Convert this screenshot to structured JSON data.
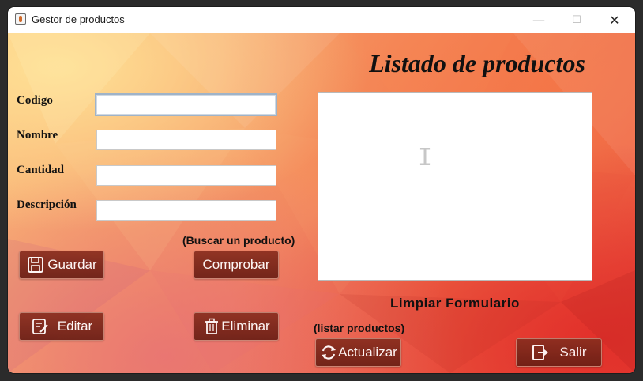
{
  "window": {
    "title": "Gestor de productos",
    "controls": {
      "minimize": "—",
      "maximize": "☐",
      "close": "✕"
    }
  },
  "heading": "Listado de productos",
  "form": {
    "codigo_label": "Codigo",
    "codigo_value": "",
    "nombre_label": "Nombre",
    "nombre_value": "",
    "cantidad_label": "Cantidad",
    "cantidad_value": "",
    "descripcion_label": "Descripción",
    "descripcion_value": ""
  },
  "hints": {
    "buscar": "(Buscar un producto)",
    "listar": "(listar productos)"
  },
  "buttons": {
    "guardar": "Guardar",
    "comprobar": "Comprobar",
    "editar": "Editar",
    "eliminar": "Eliminar",
    "actualizar": "Actualizar",
    "salir": "Salir"
  },
  "limpiar": "Limpiar Formulario",
  "icons": {
    "save": "save-icon",
    "edit": "edit-icon",
    "delete": "trash-icon",
    "refresh": "refresh-icon",
    "exit": "exit-icon"
  },
  "colors": {
    "button_bg": "#7a2619",
    "background_top": "#fbc07d",
    "background_bottom": "#e7453a"
  }
}
